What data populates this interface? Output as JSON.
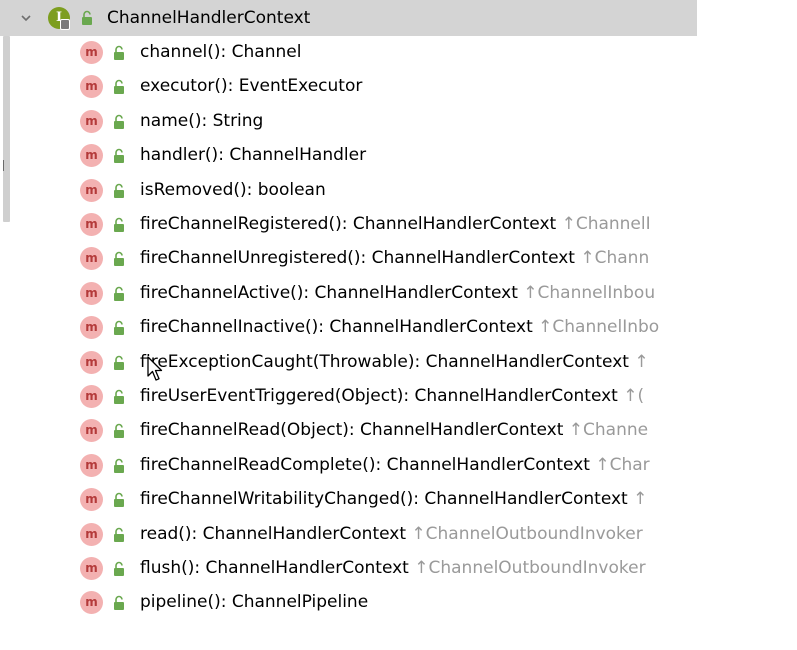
{
  "structure": {
    "expanded": true,
    "interface": {
      "icon": "interface-icon",
      "letter": "I",
      "name": "ChannelHandlerContext",
      "visibility_icon": "public-lock-icon"
    },
    "members": [
      {
        "name": "channel(): Channel",
        "origin": ""
      },
      {
        "name": "executor(): EventExecutor",
        "origin": ""
      },
      {
        "name": "name(): String",
        "origin": ""
      },
      {
        "name": "handler(): ChannelHandler",
        "origin": ""
      },
      {
        "name": "isRemoved(): boolean",
        "origin": ""
      },
      {
        "name": "fireChannelRegistered(): ChannelHandlerContext",
        "origin": "↑ChannelI"
      },
      {
        "name": "fireChannelUnregistered(): ChannelHandlerContext",
        "origin": "↑Chann"
      },
      {
        "name": "fireChannelActive(): ChannelHandlerContext",
        "origin": "↑ChannelInbou"
      },
      {
        "name": "fireChannelInactive(): ChannelHandlerContext",
        "origin": "↑ChannelInbo"
      },
      {
        "name": "fireExceptionCaught(Throwable): ChannelHandlerContext",
        "origin": "↑"
      },
      {
        "name": "fireUserEventTriggered(Object): ChannelHandlerContext",
        "origin": "↑("
      },
      {
        "name": "fireChannelRead(Object): ChannelHandlerContext",
        "origin": "↑Channe"
      },
      {
        "name": "fireChannelReadComplete(): ChannelHandlerContext",
        "origin": "↑Char"
      },
      {
        "name": "fireChannelWritabilityChanged(): ChannelHandlerContext",
        "origin": "↑"
      },
      {
        "name": "read(): ChannelHandlerContext",
        "origin": "↑ChannelOutboundInvoker"
      },
      {
        "name": "flush(): ChannelHandlerContext",
        "origin": "↑ChannelOutboundInvoker"
      },
      {
        "name": "pipeline(): ChannelPipeline",
        "origin": ""
      }
    ],
    "member_icon": "method-icon",
    "member_icon_letter": "m"
  },
  "colors": {
    "header_bg": "#d4d4d4",
    "method_icon_bg": "#f3b1b1",
    "method_icon_fg": "#b43a3a",
    "interface_icon_bg": "#7d9e1f",
    "lock_green": "#6aa84f",
    "origin_text": "#9a9a9a"
  }
}
